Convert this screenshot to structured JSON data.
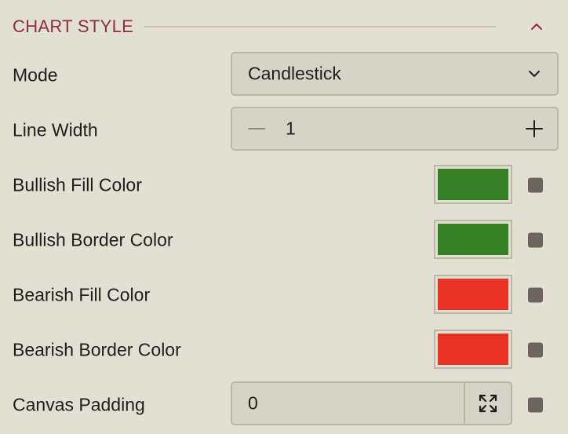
{
  "section": {
    "title": "CHART STYLE",
    "collapse_icon": "chevron-up-icon"
  },
  "mode": {
    "label": "Mode",
    "value": "Candlestick",
    "icon": "chevron-down-icon"
  },
  "line_width": {
    "label": "Line Width",
    "value": "1",
    "minus_icon": "minus-icon",
    "plus_icon": "plus-icon"
  },
  "bullish_fill": {
    "label": "Bullish Fill Color",
    "color": "#358023"
  },
  "bullish_border": {
    "label": "Bullish Border Color",
    "color": "#358023"
  },
  "bearish_fill": {
    "label": "Bearish Fill Color",
    "color": "#ea3324"
  },
  "bearish_border": {
    "label": "Bearish Border Color",
    "color": "#ea3324"
  },
  "canvas_padding": {
    "label": "Canvas Padding",
    "value": "0",
    "icon": "expand-icon"
  },
  "colors": {
    "accent": "#8e2f3a",
    "background": "#e2dfd3",
    "field_background": "#d6d3c7",
    "reset_dot": "#6d6460"
  }
}
